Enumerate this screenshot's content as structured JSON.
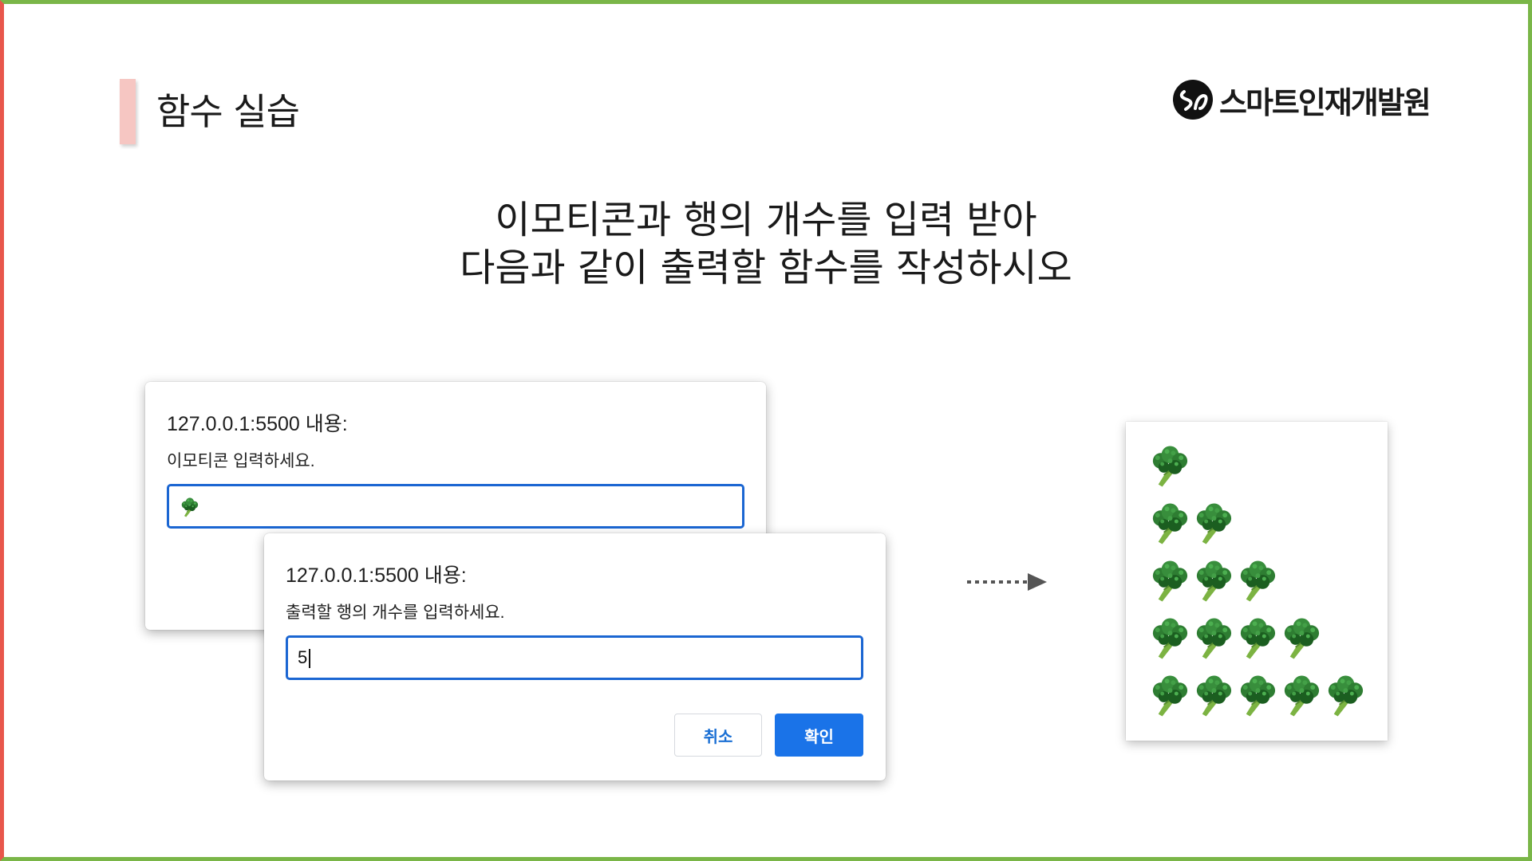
{
  "slide": {
    "title": "함수 실습",
    "logo_text": "스마트인재개발원",
    "logo_icon": "smhrd-logo-icon",
    "instruction_line1": "이모티콘과 행의 개수를 입력 받아",
    "instruction_line2": "다음과 같이 출력할 함수를 작성하시오"
  },
  "dialog1": {
    "origin": "127.0.0.1:5500 내용:",
    "message": "이모티콘 입력하세요.",
    "input_value": "🥦"
  },
  "dialog2": {
    "origin": "127.0.0.1:5500 내용:",
    "message": "출력할 행의 개수를 입력하세요.",
    "input_value": "5",
    "cancel_label": "취소",
    "ok_label": "확인"
  },
  "output": {
    "emoji": "🥦",
    "emoji_icon": "broccoli-icon",
    "row_counts": [
      1,
      2,
      3,
      4,
      5
    ]
  },
  "colors": {
    "frame_top": "#7ab648",
    "frame_left": "#e8564b",
    "accent_bar": "#f6c6c2",
    "input_border": "#1b66d2",
    "ok_button": "#1a73e8"
  }
}
